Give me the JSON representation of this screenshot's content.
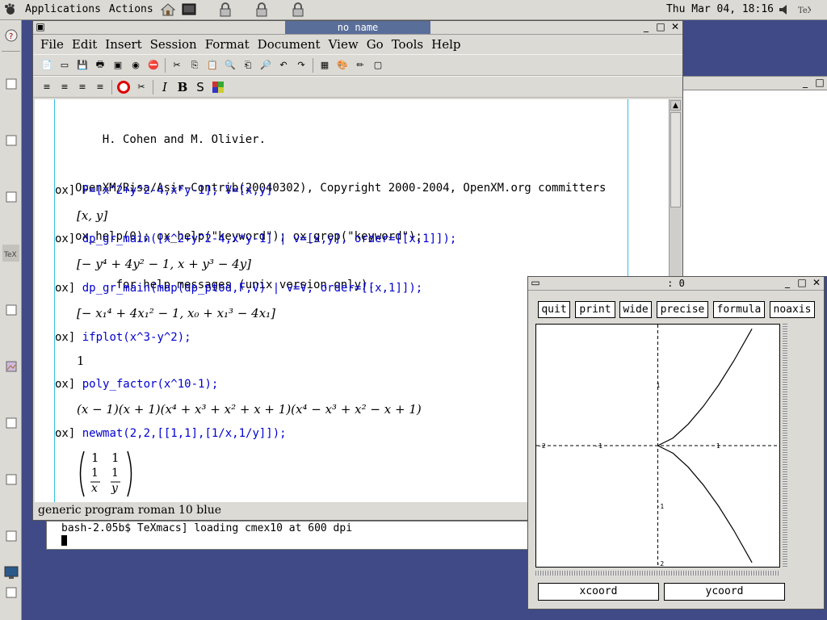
{
  "top_panel": {
    "menus": [
      "Applications",
      "Actions"
    ],
    "clock": "Thu Mar 04, 18:16"
  },
  "main_window": {
    "title": "no name",
    "menu": [
      "File",
      "Edit",
      "Insert",
      "Session",
      "Format",
      "Document",
      "View",
      "Go",
      "Tools",
      "Help"
    ],
    "format_toolbar": {
      "italic": "I",
      "bold": "B",
      "sans": "S"
    },
    "status": "generic program roman 10 blue"
  },
  "document": {
    "header_lines": [
      "    H. Cohen and M. Olivier.",
      "OpenXM/Risa/Asir-Contrib(20040302), Copyright 2000-2004, OpenXM.org committers",
      "ox_help(0); ox_help(\"keyword\"); ox_grep(\"keyword\");",
      "      for help messages (unix version only)."
    ],
    "prompt": "ox]",
    "sessions": [
      {
        "input": "F=[x^2+y^2-4,x*y-1]; V=[x,y]",
        "output": "[x, y]"
      },
      {
        "input": "dp_gr_main([x^2+y^2-4,x*y-1] | v=[x,y], order=[[x,1]]);",
        "output": "[− y⁴ + 4y² − 1, x + y³ − 4y]"
      },
      {
        "input": "dp_gr_main(map(dp_ptod,F,V) | v=V, order=[[x,1]]);",
        "output": "[− x₁⁴ + 4x₁² − 1, x₀ + x₁³ − 4x₁]"
      },
      {
        "input": "ifplot(x^3-y^2);",
        "output": "1"
      },
      {
        "input": "poly_factor(x^10-1);",
        "output": "(x − 1)(x + 1)(x⁴ + x³ + x² + x + 1)(x⁴ − x³ + x² − x + 1)"
      },
      {
        "input": "newmat(2,2,[[1,1],[1/x,1/y]]);",
        "output": ""
      }
    ],
    "matrix": {
      "r1c1": "1",
      "r1c2": "1",
      "r2c1_num": "1",
      "r2c1_den": "x",
      "r2c2_num": "1",
      "r2c2_den": "y"
    }
  },
  "terminal": {
    "line": "bash-2.05b$ TeXmacs] loading cmex10 at 600 dpi"
  },
  "plot_window": {
    "title": ": 0",
    "buttons": [
      "quit",
      "print",
      "wide",
      "precise",
      "formula",
      "noaxis"
    ],
    "xcoord": "xcoord",
    "ycoord": "ycoord"
  },
  "chart_data": {
    "type": "line",
    "title": "",
    "xlabel": "",
    "ylabel": "",
    "xlim": [
      -2,
      2
    ],
    "ylim": [
      -2,
      2
    ],
    "x_ticks": [
      "-2",
      "-1",
      "1"
    ],
    "y_ticks": [
      "1",
      "-1",
      "-2"
    ],
    "series": [
      {
        "points": [
          [
            0,
            0
          ],
          [
            0.25,
            0.125
          ],
          [
            0.5,
            0.354
          ],
          [
            0.75,
            0.65
          ],
          [
            1,
            1
          ],
          [
            1.25,
            1.4
          ],
          [
            1.55,
            1.93
          ]
        ]
      },
      {
        "points": [
          [
            0,
            0
          ],
          [
            0.25,
            -0.125
          ],
          [
            0.5,
            -0.354
          ],
          [
            0.75,
            -0.65
          ],
          [
            1,
            -1
          ],
          [
            1.25,
            -1.4
          ],
          [
            1.55,
            -1.93
          ]
        ]
      }
    ]
  }
}
